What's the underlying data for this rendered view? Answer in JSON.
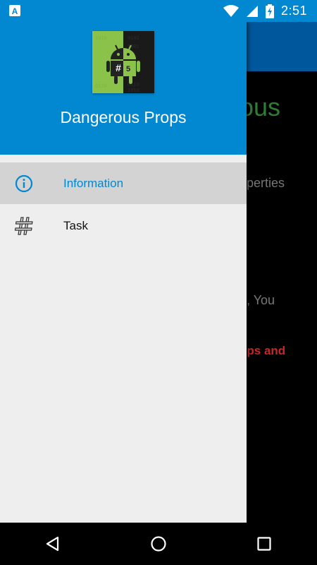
{
  "status_bar": {
    "time": "2:51",
    "left_icon": "accessibility-a-icon",
    "icons": [
      "wifi-icon",
      "signal-icon",
      "battery-charging-icon"
    ]
  },
  "background": {
    "title_fragment": "ous",
    "line1_fragment": "operties",
    "line2_fragment": "e, You",
    "line3_fragment": "ops and"
  },
  "drawer": {
    "app_title": "Dangerous Props",
    "items": [
      {
        "label": "Information",
        "icon": "info-icon",
        "active": true
      },
      {
        "label": "Task",
        "icon": "hashtag-icon",
        "active": false
      }
    ]
  },
  "nav_bar": {
    "buttons": [
      "back-icon",
      "home-icon",
      "recents-icon"
    ]
  },
  "colors": {
    "primary": "#0288d1",
    "primary_dark": "#01579b",
    "drawer_bg": "#eeeeee",
    "active_item_bg": "#d3d3d3",
    "accent_green": "#8bc34a"
  }
}
